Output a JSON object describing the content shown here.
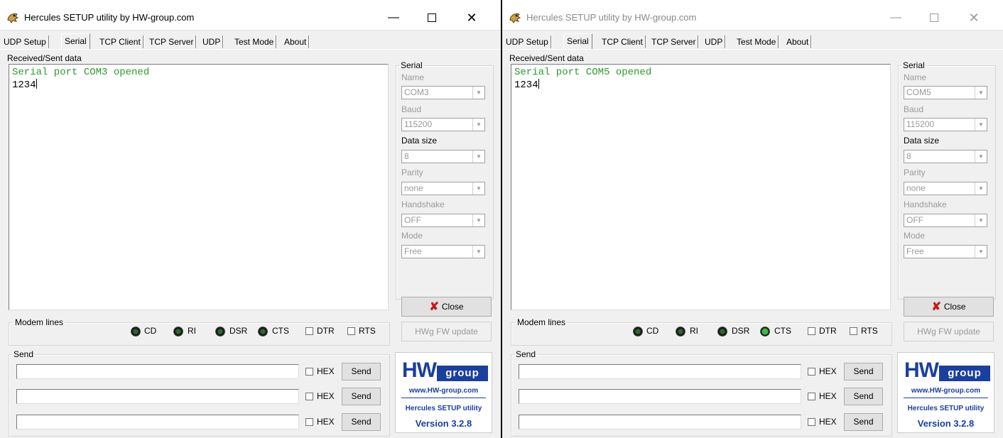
{
  "windows": [
    {
      "title": "Hercules SETUP utility by HW-group.com",
      "active": true,
      "tabs": [
        "UDP Setup",
        "Serial",
        "TCP Client",
        "TCP Server",
        "UDP",
        "Test Mode",
        "About"
      ],
      "selected_tab": "Serial",
      "received_label": "Received/Sent data",
      "received_lines": [
        "Serial port COM3 opened",
        "1234"
      ],
      "serial": {
        "legend": "Serial",
        "name_label": "Name",
        "name_value": "COM3",
        "baud_label": "Baud",
        "baud_value": "115200",
        "datasize_label": "Data size",
        "datasize_value": "8",
        "parity_label": "Parity",
        "parity_value": "none",
        "handshake_label": "Handshake",
        "handshake_value": "OFF",
        "mode_label": "Mode",
        "mode_value": "Free"
      },
      "close_label": "Close",
      "fw_update_label": "HWg FW update",
      "modem": {
        "legend": "Modem lines",
        "cd": "CD",
        "ri": "RI",
        "dsr": "DSR",
        "cts": "CTS",
        "dtr": "DTR",
        "rts": "RTS",
        "cts_lit": false
      },
      "send": {
        "legend": "Send",
        "hex_label": "HEX",
        "send_label": "Send",
        "rows": [
          "",
          "",
          ""
        ]
      },
      "logo": {
        "hw": "HW",
        "group": "group",
        "url": "www.HW-group.com",
        "app": "Hercules SETUP utility",
        "version": "Version  3.2.8"
      }
    },
    {
      "title": "Hercules SETUP utility by HW-group.com",
      "active": false,
      "tabs": [
        "UDP Setup",
        "Serial",
        "TCP Client",
        "TCP Server",
        "UDP",
        "Test Mode",
        "About"
      ],
      "selected_tab": "Serial",
      "received_label": "Received/Sent data",
      "received_lines": [
        "Serial port COM5 opened",
        "1234"
      ],
      "serial": {
        "legend": "Serial",
        "name_label": "Name",
        "name_value": "COM5",
        "baud_label": "Baud",
        "baud_value": "115200",
        "datasize_label": "Data size",
        "datasize_value": "8",
        "parity_label": "Parity",
        "parity_value": "none",
        "handshake_label": "Handshake",
        "handshake_value": "OFF",
        "mode_label": "Mode",
        "mode_value": "Free"
      },
      "close_label": "Close",
      "fw_update_label": "HWg FW update",
      "modem": {
        "legend": "Modem lines",
        "cd": "CD",
        "ri": "RI",
        "dsr": "DSR",
        "cts": "CTS",
        "dtr": "DTR",
        "rts": "RTS",
        "cts_lit": true
      },
      "send": {
        "legend": "Send",
        "hex_label": "HEX",
        "send_label": "Send",
        "rows": [
          "",
          "",
          ""
        ]
      },
      "logo": {
        "hw": "HW",
        "group": "group",
        "url": "www.HW-group.com",
        "app": "Hercules SETUP utility",
        "version": "Version  3.2.8"
      }
    }
  ],
  "colors": {
    "received_header_text": "#2e9a2e",
    "logo_blue": "#1b3f9c",
    "close_x_red": "#c81818",
    "led_lit": "#3dbb3d"
  }
}
